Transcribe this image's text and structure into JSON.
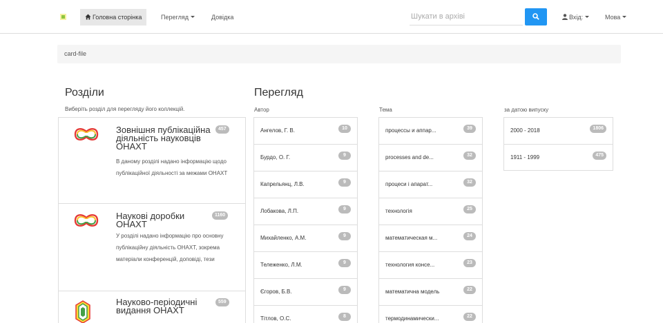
{
  "navbar": {
    "home": "Головна сторінка",
    "view": "Перегляд",
    "help": "Довідка",
    "search_placeholder": "Шукати в архіві",
    "login": "Вхід:",
    "language": "Мова"
  },
  "breadcrumb": "card-file",
  "sections": {
    "title": "Розділи",
    "subtitle": "Виберіть розділ для перегляду його коллекцій.",
    "items": [
      {
        "title": "Зовнішня публікаційна діяльність науковців ОНАХТ",
        "count": "457",
        "description": "В даному розділі надано інформацію щодо публікаційної діяльності за межами ОНАХТ"
      },
      {
        "title": "Наукові доробки ОНАХТ",
        "count": "1160",
        "description": "У розділі надано інформацію про основну публікаційну діяльність ОНАХТ, зокрема матеріали конференцій, доповіді, тези"
      },
      {
        "title": "Науково-періодичні видання ОНАХТ",
        "count": "559",
        "description": ""
      }
    ]
  },
  "browse": {
    "title": "Перегляд",
    "author": {
      "label": "Автор",
      "rows": [
        {
          "name": "Ангелов, Г. В.",
          "count": "10"
        },
        {
          "name": "Бурдо, О. Г.",
          "count": "9"
        },
        {
          "name": "Капрельянц, Л.В.",
          "count": "9"
        },
        {
          "name": "Лобакова, Л.П.",
          "count": "9"
        },
        {
          "name": "Михайленко, А.М.",
          "count": "9"
        },
        {
          "name": "Тележенко, Л.М.",
          "count": "9"
        },
        {
          "name": "Єгоров, Б.В.",
          "count": "9"
        },
        {
          "name": "Тітлов, О.С.",
          "count": "8"
        }
      ]
    },
    "topic": {
      "label": "Тема",
      "rows": [
        {
          "name": "процессы и аппар...",
          "count": "39"
        },
        {
          "name": "processes and de...",
          "count": "32"
        },
        {
          "name": "процеси і апарат...",
          "count": "32"
        },
        {
          "name": "технологія",
          "count": "25"
        },
        {
          "name": "математическая м...",
          "count": "24"
        },
        {
          "name": "технология консе...",
          "count": "23"
        },
        {
          "name": "математична модель",
          "count": "22"
        },
        {
          "name": "термодинамически...",
          "count": "22"
        }
      ]
    },
    "date": {
      "label": "за датою випуску",
      "rows": [
        {
          "name": "2000 - 2018",
          "count": "1806"
        },
        {
          "name": "1911 - 1999",
          "count": "475"
        }
      ]
    }
  },
  "colors": {
    "accent": "#2196f3",
    "badge": "#bbbbbb"
  }
}
